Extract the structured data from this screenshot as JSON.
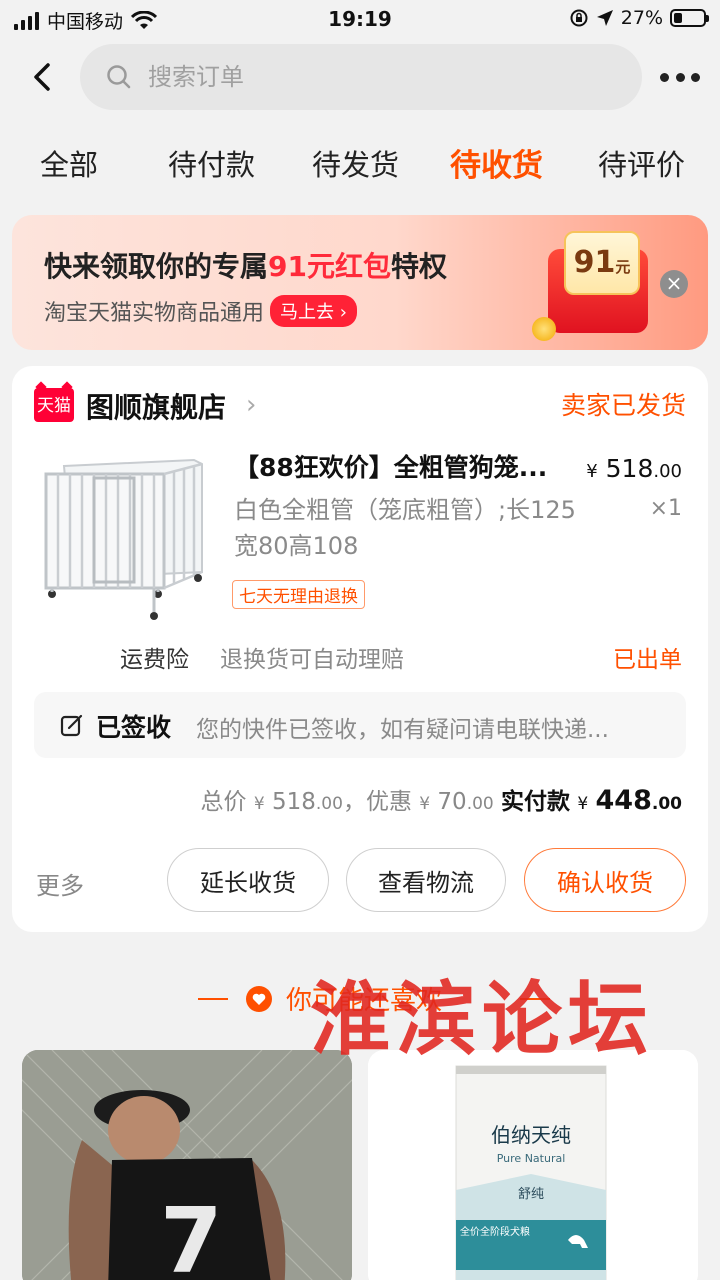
{
  "status_bar": {
    "carrier": "中国移动",
    "time": "19:19",
    "battery": "27%",
    "battery_level": 0.27
  },
  "search": {
    "placeholder": "搜索订单"
  },
  "tabs": [
    {
      "label": "全部",
      "active": false
    },
    {
      "label": "待付款",
      "active": false
    },
    {
      "label": "待发货",
      "active": false
    },
    {
      "label": "待收货",
      "active": true
    },
    {
      "label": "待评价",
      "active": false
    }
  ],
  "banner": {
    "title_prefix": "快来领取你的专属",
    "title_highlight": "91元红包",
    "title_suffix": "特权",
    "subtitle": "淘宝天猫实物商品通用",
    "cta": "马上去",
    "amount": "91",
    "amount_unit": "元"
  },
  "order": {
    "shop_badge": "天猫",
    "shop_name": "图顺旗舰店",
    "status": "卖家已发货",
    "product_title": "【88狂欢价】全粗管狗笼...",
    "price_int": "518",
    "price_dec": ".00",
    "currency": "¥",
    "quantity": "×1",
    "spec": "白色全粗管（笼底粗管）;长125宽80高108",
    "return_tag": "七天无理由退换",
    "insurance_label": "运费险",
    "insurance_desc": "退换货可自动理赔",
    "insurance_status": "已出单",
    "logistics_state": "已签收",
    "logistics_msg": "您的快件已签收，如有疑问请电联快递...",
    "total_label": "总价",
    "total_int": "518",
    "total_dec": ".00",
    "discount_label": "，优惠",
    "discount_int": "70",
    "discount_dec": ".00",
    "paid_label": "实付款",
    "paid_int": "448",
    "paid_dec": ".00",
    "more": "更多",
    "buttons": {
      "extend": "延长收货",
      "logistics": "查看物流",
      "confirm": "确认收货"
    }
  },
  "recommend": {
    "title": "你可能还喜欢"
  },
  "rec_products": [
    {
      "jersey_number": "7"
    },
    {
      "brand": "伯纳天纯",
      "brand_en": "Pure Natural",
      "subline": "舒纯",
      "tagline": "全价全阶段犬粮"
    }
  ],
  "watermark": "淮滨论坛",
  "colors": {
    "accent": "#ff5000",
    "tmall_red": "#ff0036",
    "banner_red": "#ff2a3a"
  }
}
